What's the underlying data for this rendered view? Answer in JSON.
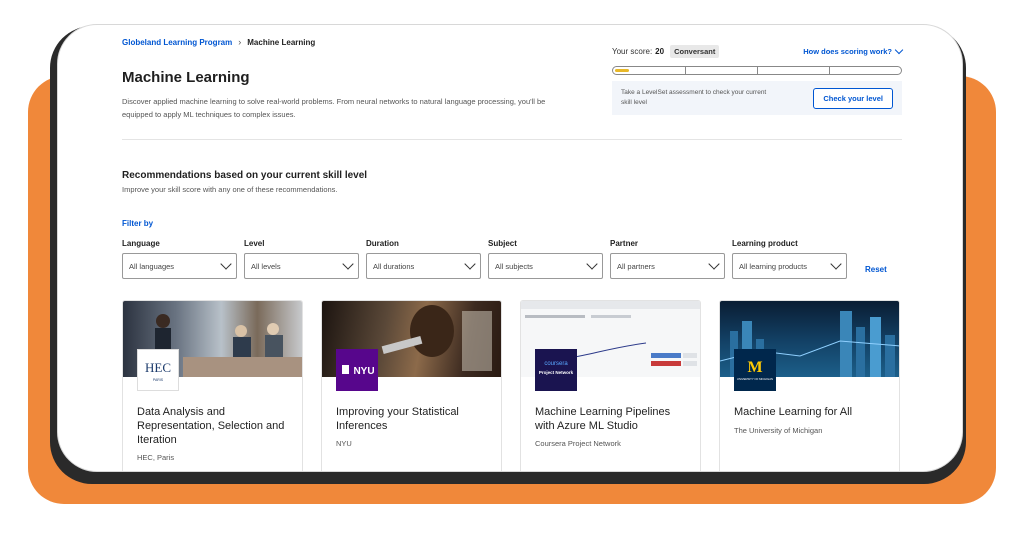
{
  "breadcrumb": {
    "parent": "Globeland Learning Program",
    "current": "Machine Learning"
  },
  "page": {
    "title": "Machine Learning",
    "description": "Discover applied machine learning to solve real-world problems. From neural networks to natural language processing, you'll be equipped to apply ML techniques to complex issues."
  },
  "score": {
    "label": "Your score:",
    "value": "20",
    "level": "Conversant",
    "help_link": "How does scoring work?",
    "progress_fraction": 0.05,
    "levelset_text": "Take a LevelSet assessment to check your current skill level",
    "check_button": "Check your level"
  },
  "recommendations": {
    "title": "Recommendations based on your current skill level",
    "subtitle": "Improve your skill score with any one of these recommendations."
  },
  "filters": {
    "heading": "Filter by",
    "reset": "Reset",
    "items": [
      {
        "label": "Language",
        "value": "All languages"
      },
      {
        "label": "Level",
        "value": "All levels"
      },
      {
        "label": "Duration",
        "value": "All durations"
      },
      {
        "label": "Subject",
        "value": "All subjects"
      },
      {
        "label": "Partner",
        "value": "All partners"
      },
      {
        "label": "Learning product",
        "value": "All learning products"
      }
    ]
  },
  "courses": [
    {
      "title": "Data Analysis and Representation, Selection and Iteration",
      "partner": "HEC, Paris",
      "logo_text": "HEC",
      "logo_sub": "PARIS"
    },
    {
      "title": "Improving your Statistical Inferences",
      "partner": "NYU",
      "logo_text": "NYU"
    },
    {
      "title": "Machine Learning Pipelines with Azure ML Studio",
      "partner": "Coursera Project Network",
      "logo_text": "coursera",
      "logo_sub": "Project Network"
    },
    {
      "title": "Machine Learning for All",
      "partner": "The University of Michigan",
      "logo_text": "M",
      "logo_sub": "UNIVERSITY OF MICHIGAN"
    }
  ],
  "colors": {
    "accent": "#0056d2",
    "background_frame": "#f0883a",
    "progress": "#e8b829"
  }
}
